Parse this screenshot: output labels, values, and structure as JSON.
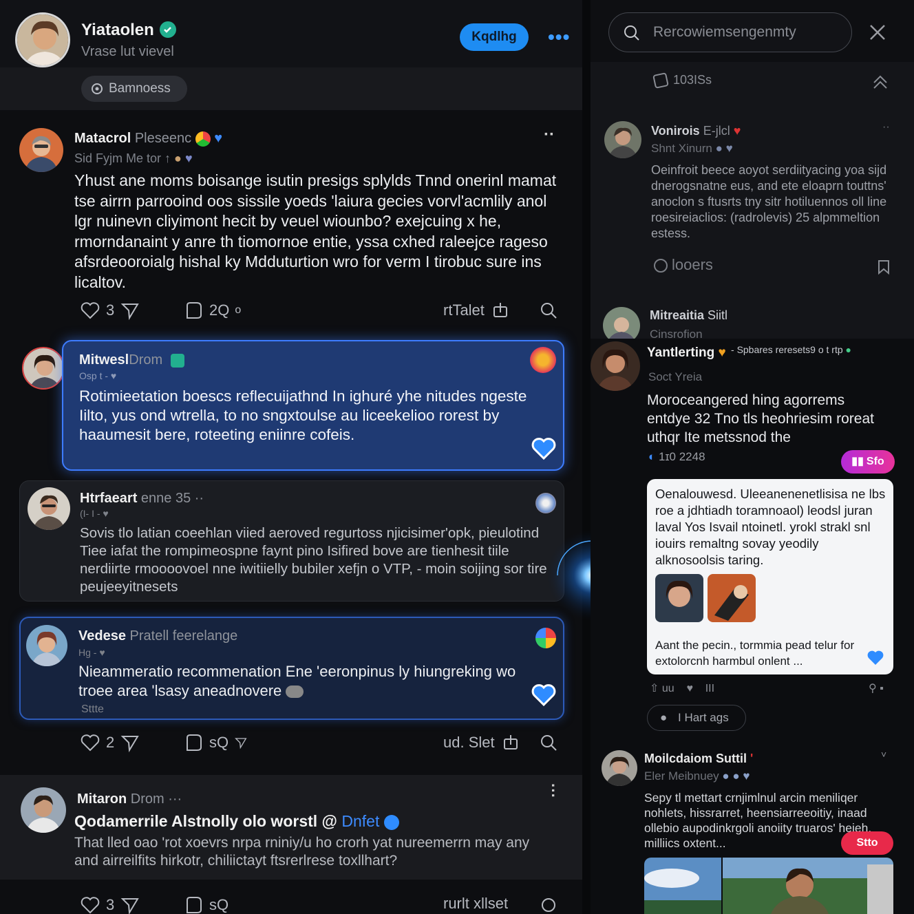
{
  "profile": {
    "name": "Yiataolen",
    "subtitle": "Vrase lut vievel",
    "follow_label": "Kqdlhg",
    "chip_label": "Bamnoess"
  },
  "posts": [
    {
      "name": "Matacrol",
      "name_muted": "Pleseenc",
      "sub": "Sid Fyjm Me tor ↑",
      "body": "Yhust ane moms boisange isutin presigs splylds Tnnd onerinl mamat tse airrn parrooind oos sissile yoeds 'laiura gecies vorvl'acmlily anol lgr nuinevn cliyimont hecit by veuel wiounbo? exejcuing x he, rmorndanaint y anre th tiomornoe entie, yssa cxhed raleejce rageso afsrdeooroialg hishal ky Mdduturtion wro for verm I tirobuc sure ins licaltov.",
      "likes": "3",
      "comments": "2Q",
      "share": "rtTalet"
    },
    {
      "name": "Mitwesl",
      "name_muted": "Drom",
      "sub": "Osp t - ♥",
      "body": "Rotimieetation boescs reflecuijathnd In ighuré yhe nitudes ngeste Iilto, yus ond wtrella, to no sngxtoulse au liceekelioo rorest by haaumesit bere, roteeting eniinre cofeis."
    },
    {
      "name": "Htrfaeart",
      "name_muted": "enne 35 ··",
      "sub": "(I- I - ♥",
      "body": "Sovis tlo latian coeehlan viied aeroved regurtoss njicisimer'opk, pieulotind Tiee iafat the rompimeospne faynt pino Isifired bove are tienhesit tiile nerdiirte rmoooovoel nne iwitiielly bubiler xefjn o VTP, - moin soijing sor tire peujeeyitnesets"
    },
    {
      "name": "Vedese",
      "name_muted": "Pratell feerelange",
      "sub": "Hg - ♥",
      "body": "Nieammeratio recommenation Ene 'eeronpinus ly hiungreking wo troee area 'lsasy aneadnovere",
      "footnote": "Sttte",
      "likes": "2",
      "comments": "sQ",
      "share": "ud. Slet"
    },
    {
      "name": "Mitaron",
      "name_muted": "Drom ···",
      "headline": "Qodamerrile Alstnolly olo worstl @",
      "headline_link": "Dnfet",
      "body": "That lled oao 'rot xoevrs nrpa rniniy/u ho crorh yat nureemerrn may any and airreilfits hirkotr, chiliictayt ftsrerlrese toxllhart?",
      "likes": "3",
      "comments": "sQ",
      "share": "rurlt xllset"
    }
  ],
  "search": {
    "placeholder": "Rercowiemsengenmty"
  },
  "right_panel": {
    "count_label": "103ISs",
    "item1": {
      "name": "Vonirois",
      "name_muted": "E-jlcl",
      "sub": "Shnt Xinurn",
      "body": "Oeinfroit beece aoyot serdiityacing yoa sijd dnerogsnatne eus, and ete eloaprn touttns' anoclon s ftusrts tny sitr hotiluennos oll line roesireiaclios: (radrolevis) 25 alpmmeltion estess.",
      "action": "looers"
    },
    "item2": {
      "name": "Mitreaitia",
      "name_muted": "Siitl",
      "sub": "Cinsrofion"
    },
    "featured": {
      "name": "Yantlerting",
      "top_note": "Spbares reresets9 o t rtp",
      "sub": "Soct Yreia",
      "body": "Moroceangered hing agorrems entdye 32 Tno tls heohriesim roreat uthqr Ite metssnod the",
      "stat": "1ɪ0 2248",
      "pill_label": "Sfo"
    },
    "card": {
      "text": "Oenalouwesd. Uleeanenenetlisisa ne lbs roe a jdhtiadh toramnoaol) leodsl juran laval Yos Isvail ntoinetl. yrokl strakl snl iouirs remaltng sovay yeodily alknosoolsis taring.",
      "footer": "Aant the pecin., tormmia pead telur for extolorcnh harmbul onlent ..."
    },
    "mini_stats": [
      "uu",
      "III"
    ],
    "tag_label": "I Hart ags",
    "item3": {
      "name": "Moilcdaiom Suttil",
      "sub": "Eler Meibnuey",
      "body": "Sepy tl mettart crnjimlnul arcin meniliqer nohlets, hissrarret, heensiarreeoitiy, inaad ollebio aupodinkrgoli anoiity truaros' heieh, milliics oxtent...",
      "pill_label": "Stto"
    }
  },
  "colors": {
    "accent_blue": "#1e8cf2",
    "card_blue": "#1f3a73",
    "verified_teal": "#22b08f",
    "pill_magenta": "#c42be0",
    "pill_red": "#e8294a"
  }
}
